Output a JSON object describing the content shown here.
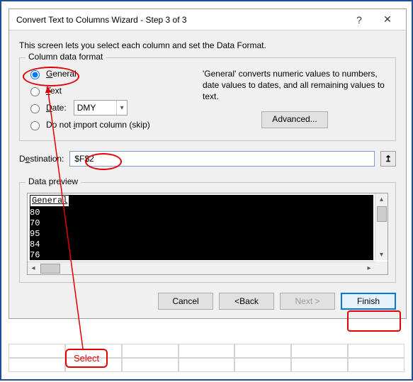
{
  "dialog": {
    "title": "Convert Text to Columns Wizard - Step 3 of 3",
    "help_glyph": "?",
    "close_glyph": "✕",
    "instruction": "This screen lets you select each column and set the Data Format.",
    "group_label": "Column data format",
    "radios": {
      "general": {
        "label": "General",
        "u": "G"
      },
      "text": {
        "label": "Text",
        "u": "T"
      },
      "date": {
        "label": "Date:",
        "u": "D",
        "value": "DMY"
      },
      "skip": {
        "label": "Do not import column (skip)",
        "u": "I"
      }
    },
    "description": "'General' converts numeric values to numbers, date values to dates, and all remaining values to text.",
    "advanced_label": "Advanced...",
    "destination_label": "Destination:",
    "destination_u": "E",
    "destination_value": "$F$2",
    "ref_glyph": "↥",
    "preview_label": "Data preview",
    "preview_header": "General",
    "preview_rows": [
      "80",
      "70",
      "95",
      "84",
      "76"
    ],
    "buttons": {
      "cancel": "Cancel",
      "back": "< Back",
      "next": "Next >",
      "finish": "Finish"
    }
  },
  "annotation": {
    "select": "Select"
  }
}
